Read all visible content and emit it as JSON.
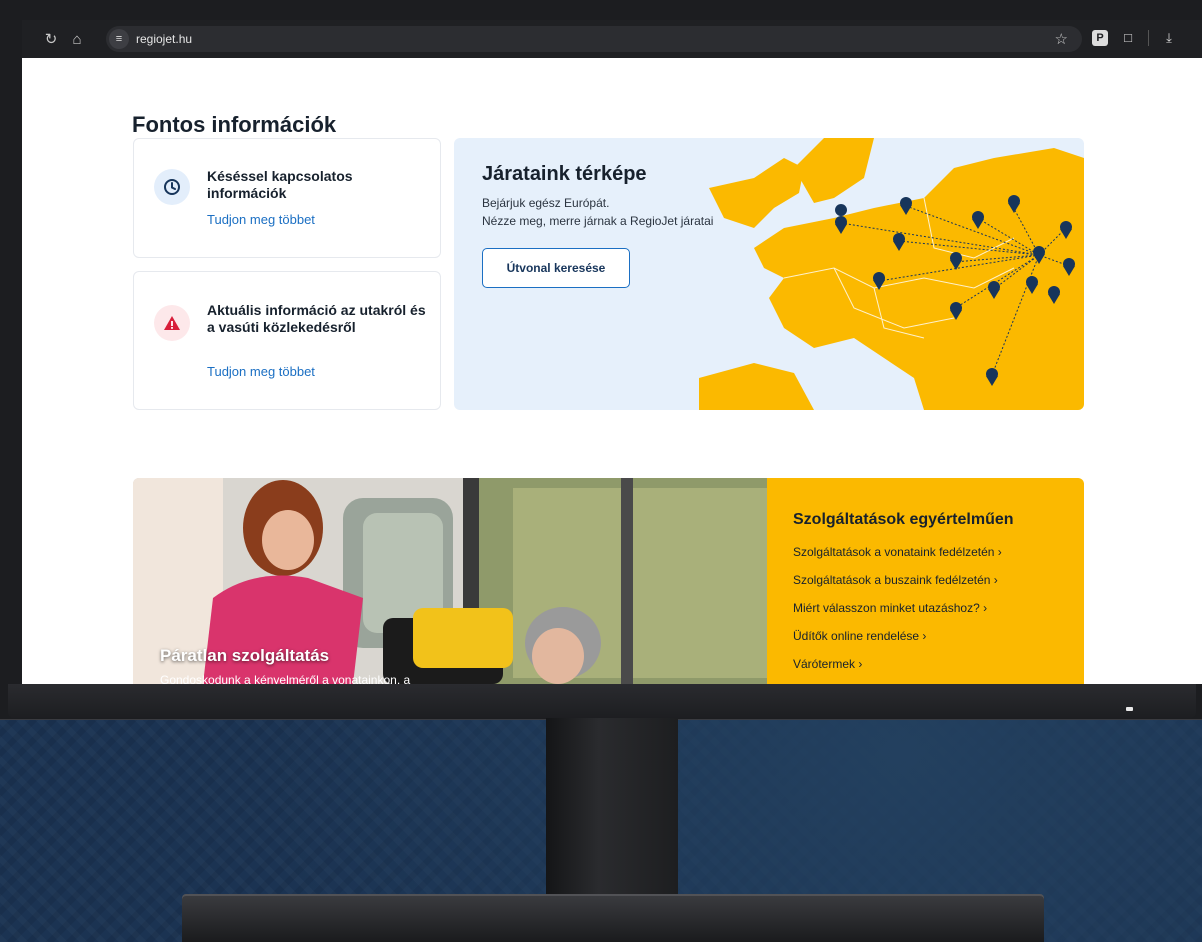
{
  "browser": {
    "url": "regiojet.hu",
    "nav_icons": [
      "reload-icon",
      "home-icon"
    ],
    "extension_icons": [
      "bookmark-star-icon",
      "extension-box-icon",
      "puzzle-icon",
      "download-icon"
    ]
  },
  "page": {
    "heading": "Fontos információk",
    "cards": [
      {
        "title": "Késéssel kapcsolatos információk",
        "link": "Tudjon meg többet",
        "icon": "clock-icon",
        "accent": "#1b6fc3"
      },
      {
        "title": "Aktuális információ az utakról és a vasúti közlekedésről",
        "link": "Tudjon meg többet",
        "icon": "warning-icon",
        "accent": "#d81e3a"
      }
    ],
    "map": {
      "title": "Járataink térképe",
      "line1": "Bejárjuk egész Európát.",
      "line2": "Nézze meg, merre járnak a RegioJet járatai",
      "button": "Útvonal keresése",
      "land_color": "#fbb900",
      "sea_color": "#e6f0fb",
      "pin_color": "#17355b"
    },
    "promo": {
      "photo_title": "Páratlan szolgáltatás",
      "photo_subtitle": "Gondoskodunk a kényelméről a vonatainkon, a",
      "services_title": "Szolgáltatások egyértelműen",
      "services": [
        "Szolgáltatások a vonataink fedélzetén ›",
        "Szolgáltatások a buszaink fedélzetén ›",
        "Miért válasszon minket utazáshoz? ›",
        "Üdítők online rendelése ›",
        "Várótermek ›"
      ],
      "services_bg": "#fbb900"
    }
  }
}
